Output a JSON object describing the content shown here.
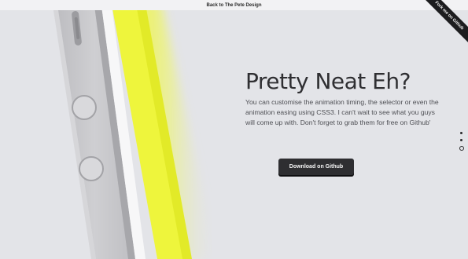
{
  "topbar": {
    "back_link": "Back to The Pete Design"
  },
  "ribbon": {
    "label": "Fork me on Github"
  },
  "hero": {
    "headline": "Pretty Neat Eh?",
    "description": "You can customise the animation timing, the selector or even the animation easing using CSS3. I can't wait to see what you guys will come up with. Don't forget to grab them for free on Github'",
    "button_label": "Download on Github"
  },
  "pagination": {
    "count": 3,
    "active_index": 2
  },
  "colors": {
    "background": "#e3e4e8",
    "accent_yellow": "#eef53c",
    "button": "#2e2e31",
    "phone_body": "#c9c9cc"
  },
  "icons": [
    "phone-illustration",
    "github-ribbon"
  ]
}
